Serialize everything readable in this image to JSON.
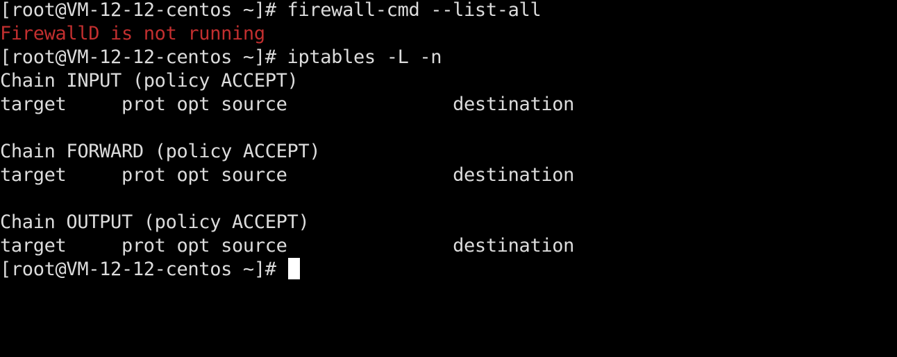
{
  "terminal": {
    "background_color": "#000000",
    "foreground_color": "#dcdcdc",
    "error_color": "#c22f2f",
    "cursor_color": "#ffffff",
    "prompt": "[root@VM-12-12-centos ~]# ",
    "hostname": "VM-12-12-centos",
    "user": "root",
    "cwd": "~",
    "lines": [
      {
        "id": "line-1",
        "type": "prompt",
        "text": "[root@VM-12-12-centos ~]# firewall-cmd --list-all"
      },
      {
        "id": "line-2",
        "type": "error",
        "text": "FirewallD is not running"
      },
      {
        "id": "line-3",
        "type": "prompt",
        "text": "[root@VM-12-12-centos ~]# iptables -L -n"
      },
      {
        "id": "line-4",
        "type": "output",
        "text": "Chain INPUT (policy ACCEPT)"
      },
      {
        "id": "line-5",
        "type": "output",
        "text": "target     prot opt source               destination"
      },
      {
        "id": "line-6",
        "type": "blank",
        "text": ""
      },
      {
        "id": "line-7",
        "type": "output",
        "text": "Chain FORWARD (policy ACCEPT)"
      },
      {
        "id": "line-8",
        "type": "output",
        "text": "target     prot opt source               destination"
      },
      {
        "id": "line-9",
        "type": "blank",
        "text": ""
      },
      {
        "id": "line-10",
        "type": "output",
        "text": "Chain OUTPUT (policy ACCEPT)"
      },
      {
        "id": "line-11",
        "type": "output",
        "text": "target     prot opt source               destination"
      },
      {
        "id": "line-12",
        "type": "prompt",
        "text": "[root@VM-12-12-centos ~]# "
      }
    ],
    "commands": [
      "firewall-cmd --list-all",
      "iptables -L -n"
    ],
    "chains": [
      {
        "name": "INPUT",
        "policy": "ACCEPT",
        "rules": []
      },
      {
        "name": "FORWARD",
        "policy": "ACCEPT",
        "rules": []
      },
      {
        "name": "OUTPUT",
        "policy": "ACCEPT",
        "rules": []
      }
    ],
    "table_headers": [
      "target",
      "prot",
      "opt",
      "source",
      "destination"
    ],
    "cursor": {
      "visible": true,
      "style": "block"
    }
  }
}
